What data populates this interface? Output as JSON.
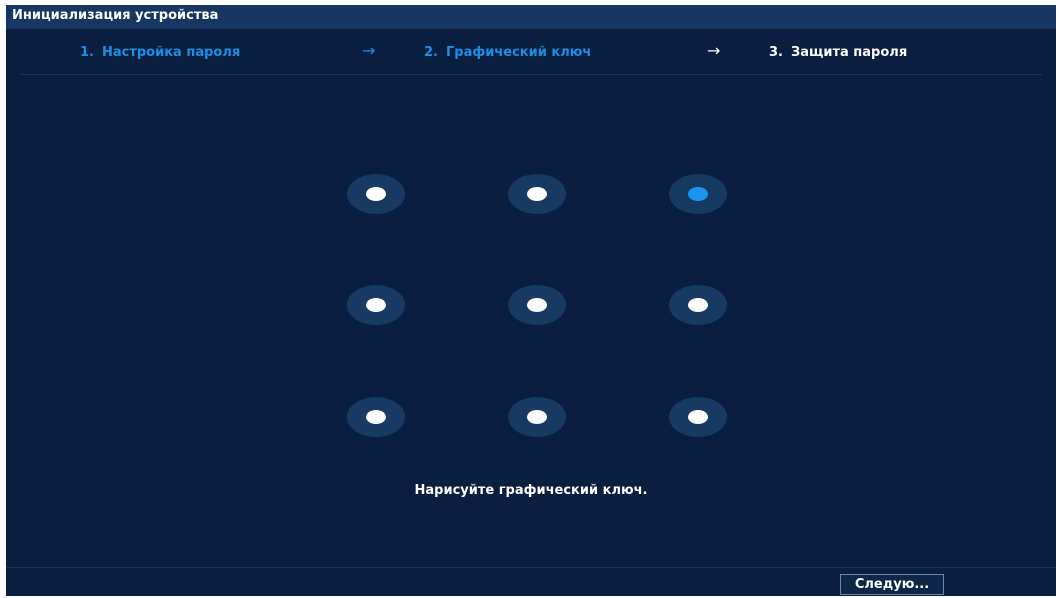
{
  "window": {
    "title": "Инициализация устройства"
  },
  "steps": [
    {
      "number": "1.",
      "label": "Настройка пароля",
      "state": "done"
    },
    {
      "number": "2.",
      "label": "Графический ключ",
      "state": "active"
    },
    {
      "number": "3.",
      "label": "Защита пароля",
      "state": "pending"
    }
  ],
  "arrows": [
    "→",
    "→"
  ],
  "pattern": {
    "grid_size": "3x3",
    "selected_dots": [
      3
    ],
    "dots": [
      "1",
      "2",
      "3",
      "4",
      "5",
      "6",
      "7",
      "8",
      "9"
    ]
  },
  "hint": "Нарисуйте графический ключ.",
  "footer": {
    "next_label": "Следую..."
  },
  "colors": {
    "background": "#0a1e3f",
    "titlebar": "#163762",
    "accent": "#1a8fe6",
    "dot_ring": "#173a62",
    "dot_selected": "#1a96ee"
  }
}
